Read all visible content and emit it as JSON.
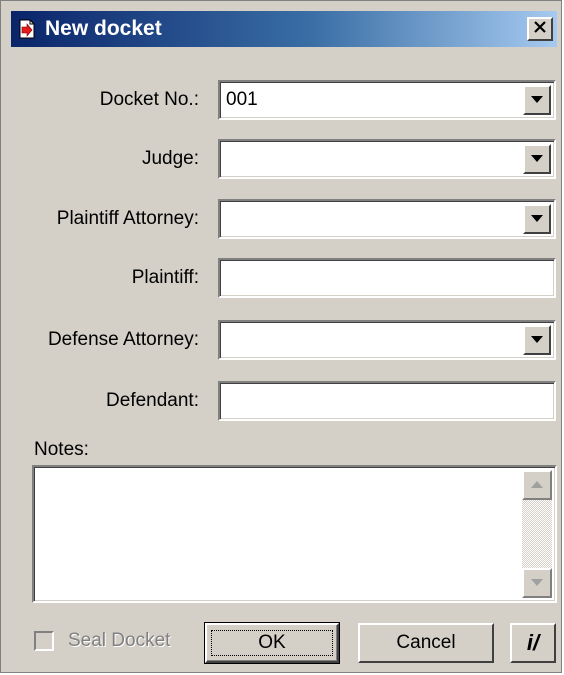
{
  "window": {
    "title": "New docket",
    "close_label": "✕"
  },
  "fields": {
    "docket_no": {
      "label": "Docket No.:",
      "value": "001"
    },
    "judge": {
      "label": "Judge:",
      "value": ""
    },
    "plaintiff_attorney": {
      "label": "Plaintiff Attorney:",
      "value": ""
    },
    "plaintiff": {
      "label": "Plaintiff:",
      "value": ""
    },
    "defense_attorney": {
      "label": "Defense Attorney:",
      "value": ""
    },
    "defendant": {
      "label": "Defendant:",
      "value": ""
    }
  },
  "notes": {
    "label": "Notes:",
    "value": ""
  },
  "footer": {
    "seal_label": "Seal Docket",
    "seal_checked": false,
    "ok_label": "OK",
    "cancel_label": "Cancel",
    "info_label": "i/"
  },
  "icons": {
    "title": "document-arrow-icon",
    "close": "close-icon",
    "dropdown": "chevron-down-icon"
  },
  "colors": {
    "title_start": "#0a246a",
    "title_end": "#a6caf0",
    "face": "#d4d0c8"
  }
}
